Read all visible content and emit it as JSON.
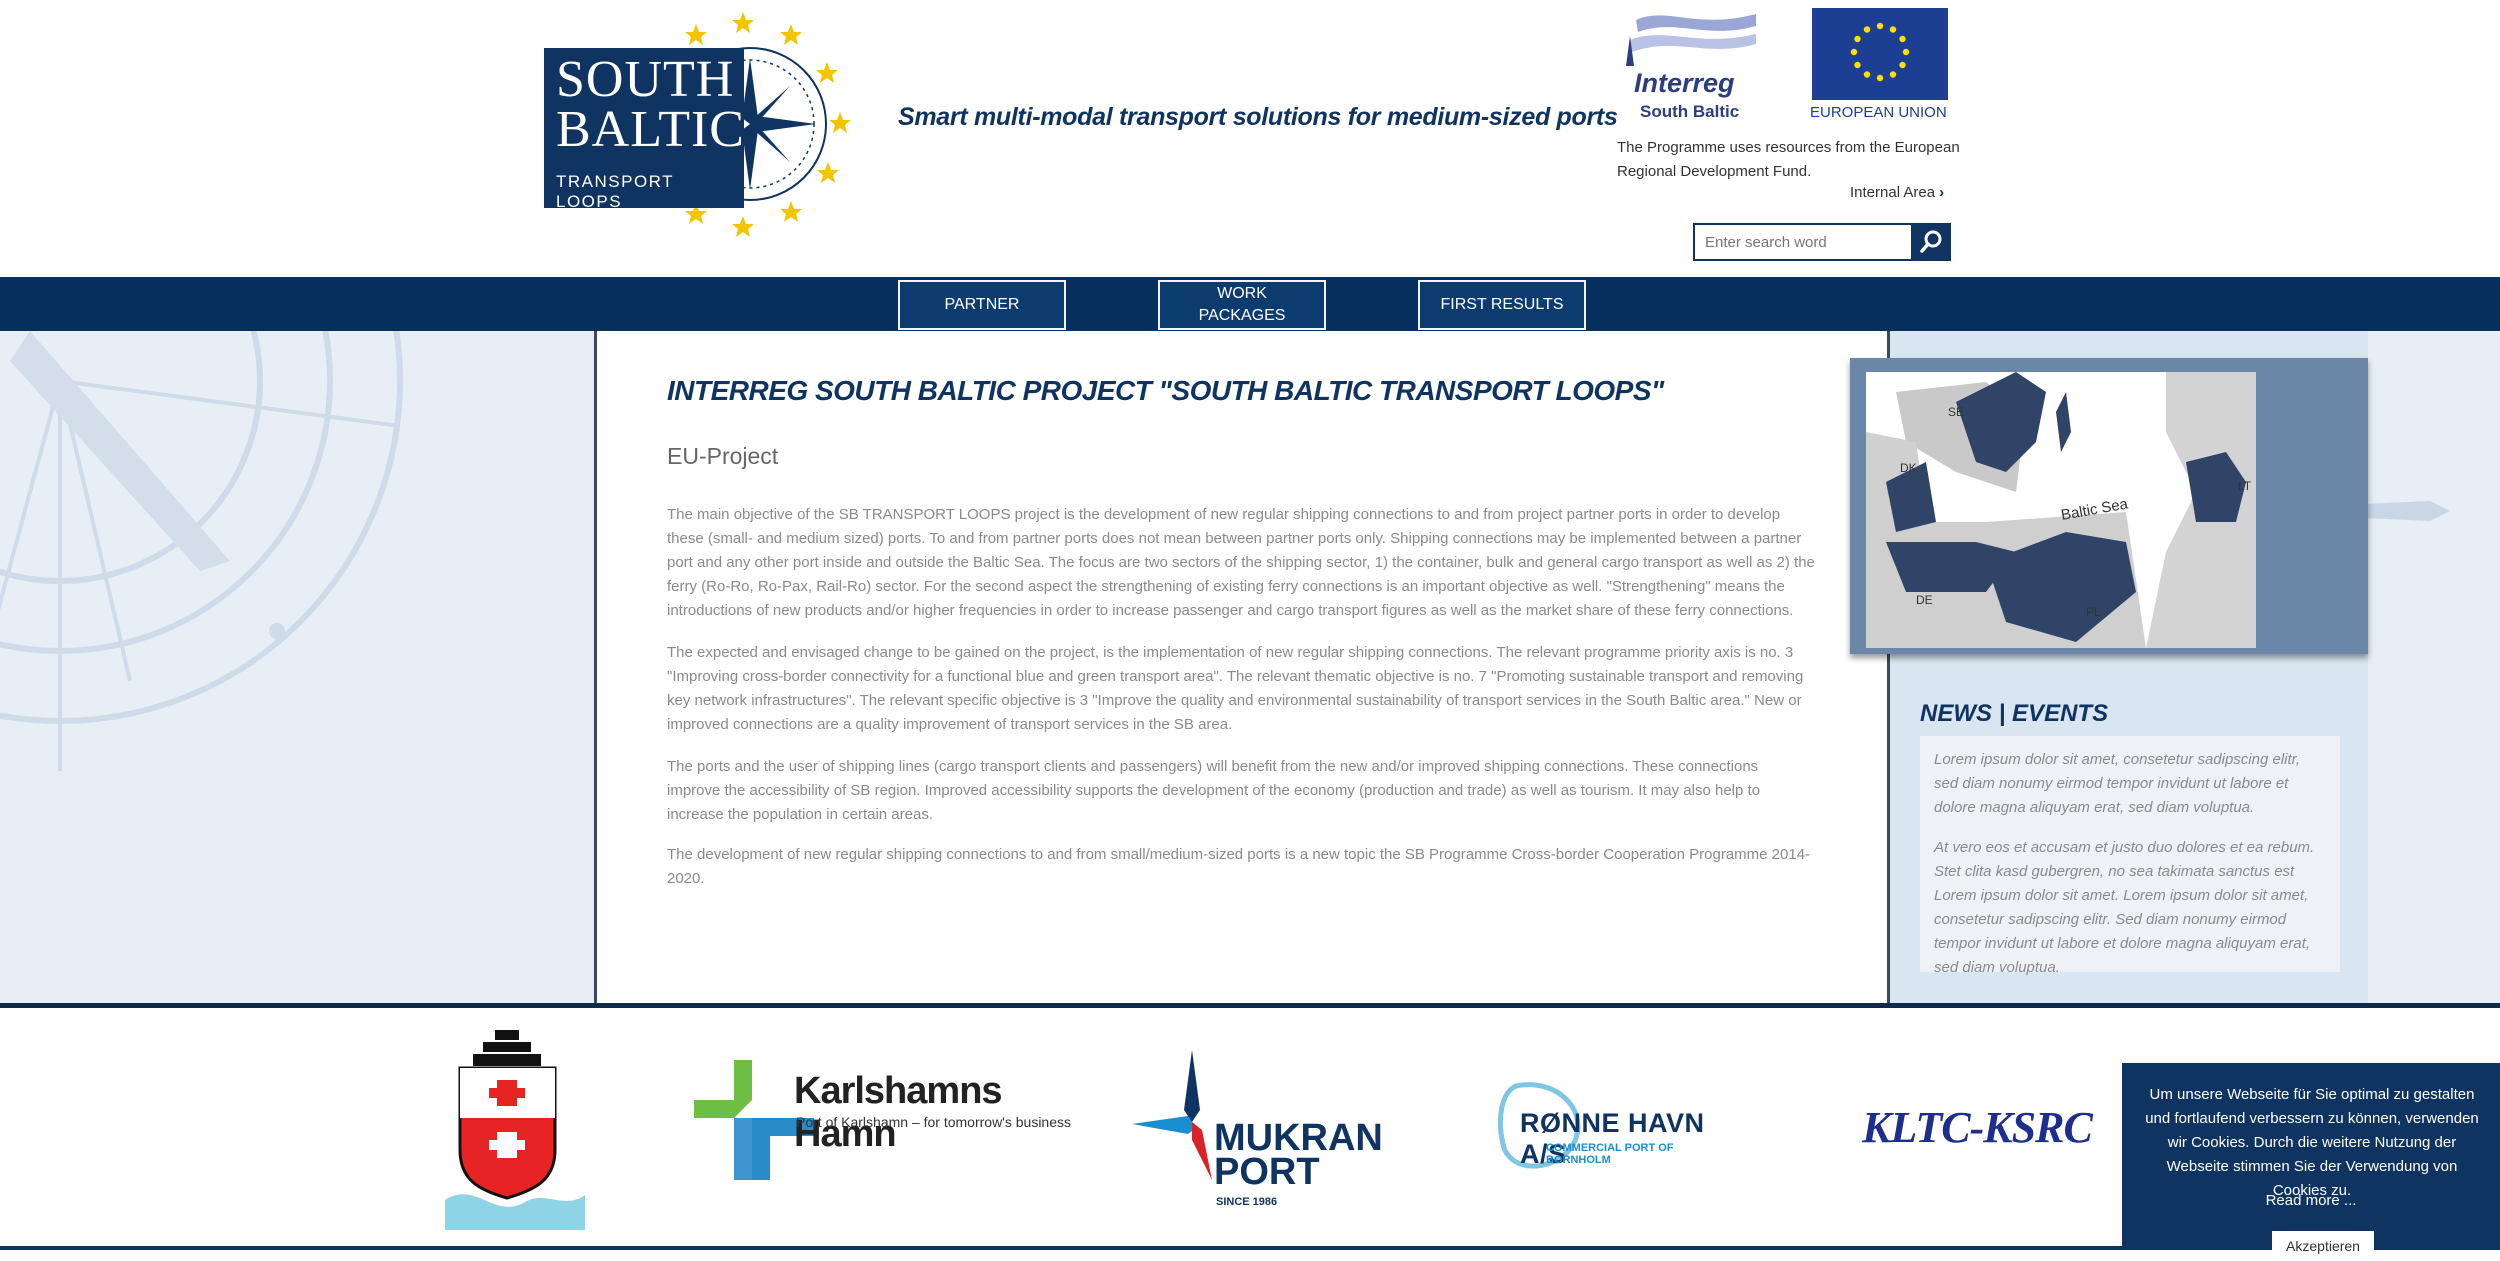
{
  "header": {
    "logo": {
      "line1": "SOUTH",
      "line2": "BALTIC",
      "line3": "TRANSPORT  LOOPS"
    },
    "tagline": "Smart multi-modal transport solutions for medium-sized ports",
    "interreg": {
      "name": "Interreg",
      "sub": "South Baltic"
    },
    "eu_label": "EUROPEAN UNION",
    "programme_text": "The Programme uses resources from the European Regional Development Fund.",
    "internal_area": "Internal Area",
    "search": {
      "placeholder": "Enter search word"
    }
  },
  "nav": {
    "items": [
      {
        "label": "PARTNER"
      },
      {
        "label": "WORK PACKAGES"
      },
      {
        "label": "FIRST RESULTS"
      }
    ]
  },
  "main": {
    "title": "INTERREG SOUTH BALTIC PROJECT \"SOUTH BALTIC TRANSPORT LOOPS\"",
    "subtitle": "EU-Project",
    "paragraphs": [
      "The main objective of the SB TRANSPORT LOOPS project is the development of new regular shipping connections to and from project partner ports in order to develop these (small- and medium sized) ports. To and from partner ports does not mean between partner ports only. Shipping connections may be implemented between a partner port and any other port inside and outside the Baltic Sea. The focus are two sectors of the shipping sector, 1) the container, bulk and general cargo transport as well as 2) the ferry (Ro-Ro, Ro-Pax, Rail-Ro) sector. For the second aspect the strengthening of existing ferry connections is an important objective as well. \"Strengthening\" means the introductions of new products and/or higher frequencies in order to increase passenger and cargo transport figures as well as the market share of these ferry connections.",
      "The expected and envisaged change to be gained on the project, is the implementation of new regular shipping connections. The relevant programme priority axis is no. 3 \"Improving cross-border connectivity for a functional blue and green transport area\". The relevant thematic objective is no. 7 \"Promoting sustainable transport and removing key network infrastructures\". The relevant specific objective is 3 \"Improve the quality and environmental sustainability of transport services in the South Baltic area.\" New or improved connections are a quality improvement of transport services in the SB area.",
      "The ports and the user of shipping lines (cargo transport clients and passengers) will benefit from the new and/or improved shipping connections. These connections improve the accessibility of SB region. Improved accessibility supports the development of the economy (production and trade) as well as tourism. It may also help to increase the population in certain areas.",
      "The development of new regular shipping connections to and from small/medium-sized ports is a new topic the SB Programme Cross-border Cooperation Programme 2014-2020."
    ]
  },
  "map": {
    "labels": {
      "se": "SE",
      "dk": "DK",
      "lt": "LT",
      "de": "DE",
      "pl": "PL",
      "sea": "Baltic Sea"
    }
  },
  "news": {
    "title": "NEWS | EVENTS",
    "items": [
      "Lorem ipsum dolor sit amet, consetetur sadipscing elitr, sed diam nonumy eirmod tempor invidunt ut labore et dolore magna aliquyam erat, sed diam voluptua.",
      "At vero eos et accusam et justo duo dolores et ea rebum. Stet clita kasd gubergren, no sea takimata sanctus est Lorem ipsum dolor sit amet. Lorem ipsum dolor sit amet, consetetur sadipscing elitr. Sed diam nonumy eirmod tempor invidunt ut labore et dolore magna aliquyam erat, sed diam voluptua."
    ]
  },
  "partners": {
    "karlshamn": {
      "name": "Karlshamns Hamn",
      "tagline": "Port of Karlshamn – for tomorrow's business"
    },
    "mukran": {
      "line1": "MUKRAN",
      "line2": "PORT",
      "since": "SINCE 1986"
    },
    "ronne": {
      "name": "RØNNE HAVN A/S",
      "sub": "COMMERCIAL PORT OF BORNHOLM"
    },
    "kltc": {
      "name": "KLTC-KSRC"
    }
  },
  "cookie": {
    "text": "Um unsere Webseite für Sie optimal zu gestalten und fortlaufend verbessern zu können, verwenden wir Cookies. Durch die weitere Nutzung der Webseite stimmen Sie der Verwendung von Cookies zu.",
    "read_more": "Read more ...",
    "accept": "Akzeptieren"
  },
  "colors": {
    "brand_navy": "#0f3462",
    "nav_bar": "#07305e",
    "side_bg": "#e7eef6",
    "star_yellow": "#f5c400"
  }
}
